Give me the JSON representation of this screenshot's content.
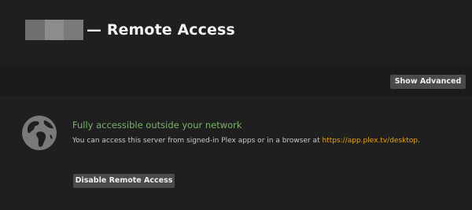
{
  "header": {
    "title": "— Remote Access"
  },
  "toolbar": {
    "show_advanced_label": "Show Advanced"
  },
  "status": {
    "title": "Fully accessible outside your network",
    "description": "You can access this server from signed-in Plex apps or in a browser at ",
    "link_text": "https://app.plex.tv/desktop",
    "description_end": "."
  },
  "actions": {
    "disable_label": "Disable Remote Access"
  },
  "colors": {
    "background": "#1f1f1f",
    "status_green": "#78b36b",
    "link_orange": "#e5a00d",
    "button_bg": "#4a4a4a"
  },
  "icons": {
    "status": "globe-icon"
  }
}
